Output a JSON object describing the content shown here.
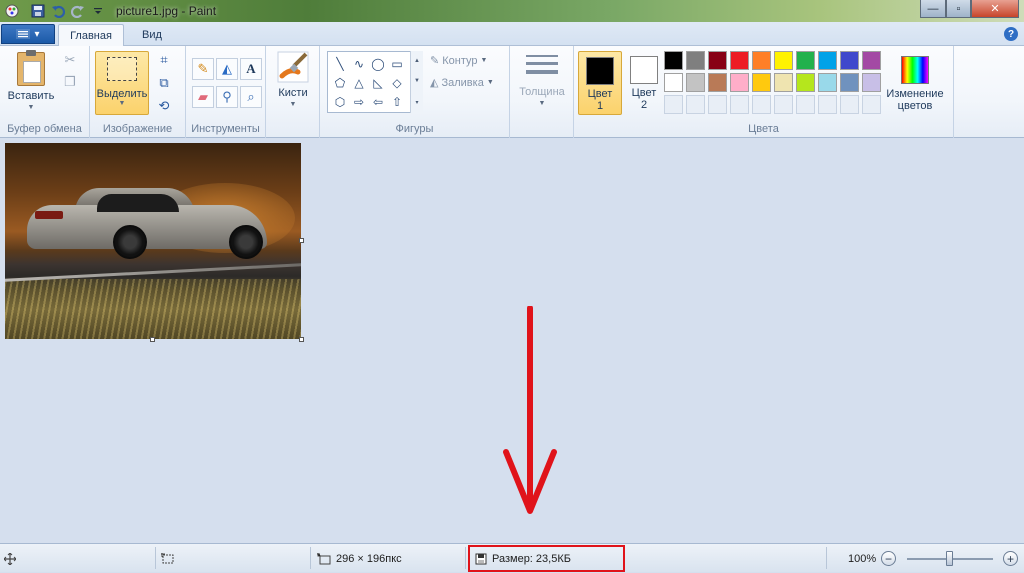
{
  "window": {
    "title": "picture1.jpg - Paint",
    "min_glyph": "—",
    "max_glyph": "▫",
    "close_glyph": "✕"
  },
  "tabs": {
    "home": "Главная",
    "view": "Вид",
    "help_glyph": "?"
  },
  "ribbon": {
    "clipboard": {
      "paste": "Вставить",
      "group": "Буфер обмена"
    },
    "image": {
      "select": "Выделить",
      "group": "Изображение"
    },
    "tools": {
      "group": "Инструменты"
    },
    "brushes": {
      "label": "Кисти"
    },
    "shapes": {
      "outline": "Контур",
      "fill": "Заливка",
      "group": "Фигуры"
    },
    "size": {
      "label": "Толщина"
    },
    "colors": {
      "color1_line1": "Цвет",
      "color1_line2": "1",
      "color2_line1": "Цвет",
      "color2_line2": "2",
      "edit_line1": "Изменение",
      "edit_line2": "цветов",
      "group": "Цвета",
      "color1": "#000000",
      "color2": "#ffffff",
      "palette_row1": [
        "#000000",
        "#7f7f7f",
        "#880015",
        "#ed1c24",
        "#ff7f27",
        "#fff200",
        "#22b14c",
        "#00a2e8",
        "#3f48cc",
        "#a349a4"
      ],
      "palette_row2": [
        "#ffffff",
        "#c3c3c3",
        "#b97a57",
        "#ffaec9",
        "#ffc90e",
        "#efe4b0",
        "#b5e61d",
        "#99d9ea",
        "#7092be",
        "#c8bfe7"
      ]
    }
  },
  "canvas": {
    "annotation_color": "#e0131a"
  },
  "status": {
    "dimensions": "296 × 196пкс",
    "file_size": "Размер: 23,5КБ",
    "zoom": "100%",
    "zoom_out": "−",
    "zoom_in": "+"
  }
}
